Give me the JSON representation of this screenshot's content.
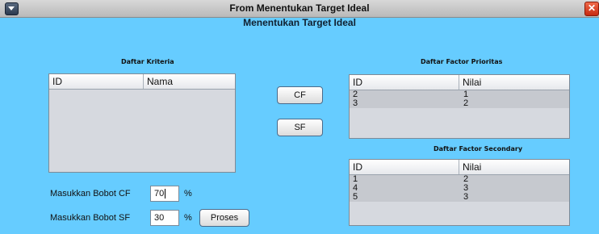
{
  "window": {
    "title": "From Menentukan Target Ideal",
    "close_glyph": "✕"
  },
  "heading": "Menentukan Target Ideal",
  "kriteria": {
    "label": "Daftar Kriteria",
    "columns": [
      "ID",
      "Nama"
    ],
    "rows": []
  },
  "buttons": {
    "cf": "CF",
    "sf": "SF",
    "proses": "Proses"
  },
  "prioritas": {
    "label": "Daftar Factor Prioritas",
    "columns": [
      "ID",
      "Nilai"
    ],
    "rows": [
      [
        "2",
        "1"
      ],
      [
        "3",
        "2"
      ]
    ]
  },
  "secondary": {
    "label": "Daftar Factor Secondary",
    "columns": [
      "ID",
      "Nilai"
    ],
    "rows": [
      [
        "1",
        "2"
      ],
      [
        "4",
        "3"
      ],
      [
        "5",
        "3"
      ]
    ]
  },
  "form": {
    "bobot_cf_label": "Masukkan Bobot CF",
    "bobot_cf_value": "70",
    "bobot_sf_label": "Masukkan Bobot SF",
    "bobot_sf_value": "30",
    "percent": "%"
  }
}
